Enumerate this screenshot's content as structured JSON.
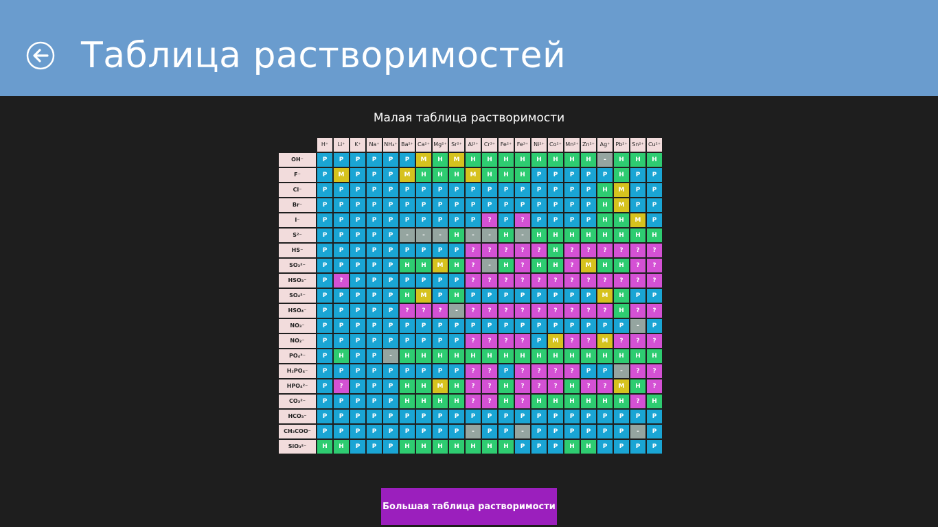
{
  "header": {
    "title": "Таблица растворимостей"
  },
  "subtitle": "Малая таблица растворимости",
  "colors": {
    "P": "#1aa5d4",
    "Н": "#2ecc71",
    "М": "#d6c21e",
    "?": "#d451d4",
    "-": "#95a5a0",
    "header_bg": "#6a9cce",
    "button_bg": "#9b1fbd"
  },
  "cations": [
    "H⁺",
    "Li⁺",
    "K⁺",
    "Na⁺",
    "NH₄⁺",
    "Ba²⁺",
    "Ca²⁺",
    "Mg²⁺",
    "Sr²⁺",
    "Al³⁺",
    "Cr³⁺",
    "Fe²⁺",
    "Fe³⁺",
    "Ni²⁺",
    "Co²⁺",
    "Mn²⁺",
    "Zn²⁺",
    "Ag⁺",
    "Pb²⁺",
    "Sn²⁺",
    "Cu²⁺"
  ],
  "anions": [
    "OH⁻",
    "F⁻",
    "Cl⁻",
    "Br⁻",
    "I⁻",
    "S²⁻",
    "HS⁻",
    "SO₃²⁻",
    "HSO₃⁻",
    "SO₄²⁻",
    "HSO₄⁻",
    "NO₃⁻",
    "NO₂⁻",
    "PO₄³⁻",
    "H₂PO₄⁻",
    "HPO₄²⁻",
    "CO₃²⁻",
    "HCO₃⁻",
    "CH₃COO⁻",
    "SiO₃²⁻"
  ],
  "rows": [
    [
      "P",
      "P",
      "P",
      "P",
      "P",
      "P",
      "М",
      "Н",
      "М",
      "Н",
      "Н",
      "Н",
      "Н",
      "Н",
      "Н",
      "Н",
      "Н",
      "-",
      "Н",
      "Н",
      "Н"
    ],
    [
      "P",
      "М",
      "P",
      "P",
      "P",
      "М",
      "Н",
      "Н",
      "Н",
      "М",
      "Н",
      "Н",
      "Н",
      "P",
      "P",
      "P",
      "P",
      "P",
      "Н",
      "P",
      "P"
    ],
    [
      "P",
      "P",
      "P",
      "P",
      "P",
      "P",
      "P",
      "P",
      "P",
      "P",
      "P",
      "P",
      "P",
      "P",
      "P",
      "P",
      "P",
      "Н",
      "М",
      "P",
      "P"
    ],
    [
      "P",
      "P",
      "P",
      "P",
      "P",
      "P",
      "P",
      "P",
      "P",
      "P",
      "P",
      "P",
      "P",
      "P",
      "P",
      "P",
      "P",
      "Н",
      "М",
      "P",
      "P"
    ],
    [
      "P",
      "P",
      "P",
      "P",
      "P",
      "P",
      "P",
      "P",
      "P",
      "P",
      "?",
      "P",
      "?",
      "P",
      "P",
      "P",
      "P",
      "Н",
      "Н",
      "М",
      "P"
    ],
    [
      "P",
      "P",
      "P",
      "P",
      "P",
      "-",
      "-",
      "-",
      "Н",
      "-",
      "-",
      "Н",
      "-",
      "Н",
      "Н",
      "Н",
      "Н",
      "Н",
      "Н",
      "Н",
      "Н"
    ],
    [
      "P",
      "P",
      "P",
      "P",
      "P",
      "P",
      "P",
      "P",
      "P",
      "?",
      "?",
      "?",
      "?",
      "?",
      "Н",
      "?",
      "?",
      "?",
      "?",
      "?",
      "?"
    ],
    [
      "P",
      "P",
      "P",
      "P",
      "P",
      "Н",
      "Н",
      "М",
      "Н",
      "?",
      "-",
      "Н",
      "?",
      "Н",
      "Н",
      "?",
      "М",
      "Н",
      "Н",
      "?",
      "?"
    ],
    [
      "P",
      "?",
      "P",
      "P",
      "P",
      "P",
      "P",
      "P",
      "P",
      "?",
      "?",
      "?",
      "?",
      "?",
      "?",
      "?",
      "?",
      "?",
      "?",
      "?",
      "?"
    ],
    [
      "P",
      "P",
      "P",
      "P",
      "P",
      "Н",
      "М",
      "P",
      "Н",
      "P",
      "P",
      "P",
      "P",
      "P",
      "P",
      "P",
      "P",
      "М",
      "Н",
      "P",
      "P"
    ],
    [
      "P",
      "P",
      "P",
      "P",
      "P",
      "?",
      "?",
      "?",
      "-",
      "?",
      "?",
      "?",
      "?",
      "?",
      "?",
      "?",
      "?",
      "?",
      "Н",
      "?",
      "?"
    ],
    [
      "P",
      "P",
      "P",
      "P",
      "P",
      "P",
      "P",
      "P",
      "P",
      "P",
      "P",
      "P",
      "P",
      "P",
      "P",
      "P",
      "P",
      "P",
      "P",
      "-",
      "P"
    ],
    [
      "P",
      "P",
      "P",
      "P",
      "P",
      "P",
      "P",
      "P",
      "P",
      "?",
      "?",
      "?",
      "?",
      "P",
      "М",
      "?",
      "?",
      "М",
      "?",
      "?",
      "?"
    ],
    [
      "P",
      "Н",
      "P",
      "P",
      "-",
      "Н",
      "Н",
      "Н",
      "Н",
      "Н",
      "Н",
      "Н",
      "Н",
      "Н",
      "Н",
      "Н",
      "Н",
      "Н",
      "Н",
      "Н",
      "Н"
    ],
    [
      "P",
      "P",
      "P",
      "P",
      "P",
      "P",
      "P",
      "P",
      "P",
      "?",
      "?",
      "P",
      "?",
      "?",
      "?",
      "?",
      "P",
      "P",
      "-",
      "?",
      "?"
    ],
    [
      "P",
      "?",
      "P",
      "P",
      "P",
      "Н",
      "Н",
      "М",
      "Н",
      "?",
      "?",
      "Н",
      "?",
      "?",
      "?",
      "Н",
      "?",
      "?",
      "М",
      "Н",
      "?"
    ],
    [
      "P",
      "P",
      "P",
      "P",
      "P",
      "Н",
      "Н",
      "Н",
      "Н",
      "?",
      "?",
      "Н",
      "?",
      "Н",
      "Н",
      "Н",
      "Н",
      "Н",
      "Н",
      "?",
      "Н"
    ],
    [
      "P",
      "P",
      "P",
      "P",
      "P",
      "P",
      "P",
      "P",
      "P",
      "P",
      "P",
      "P",
      "P",
      "P",
      "P",
      "P",
      "P",
      "P",
      "P",
      "P",
      "P"
    ],
    [
      "P",
      "P",
      "P",
      "P",
      "P",
      "P",
      "P",
      "P",
      "P",
      "-",
      "P",
      "P",
      "-",
      "P",
      "P",
      "P",
      "P",
      "P",
      "P",
      "-",
      "P"
    ],
    [
      "Н",
      "Н",
      "P",
      "P",
      "P",
      "Н",
      "Н",
      "Н",
      "Н",
      "Н",
      "Н",
      "Н",
      "P",
      "P",
      "P",
      "Н",
      "Н",
      "P",
      "P",
      "P",
      "P"
    ]
  ],
  "button": {
    "label": "Большая таблица растворимости"
  }
}
